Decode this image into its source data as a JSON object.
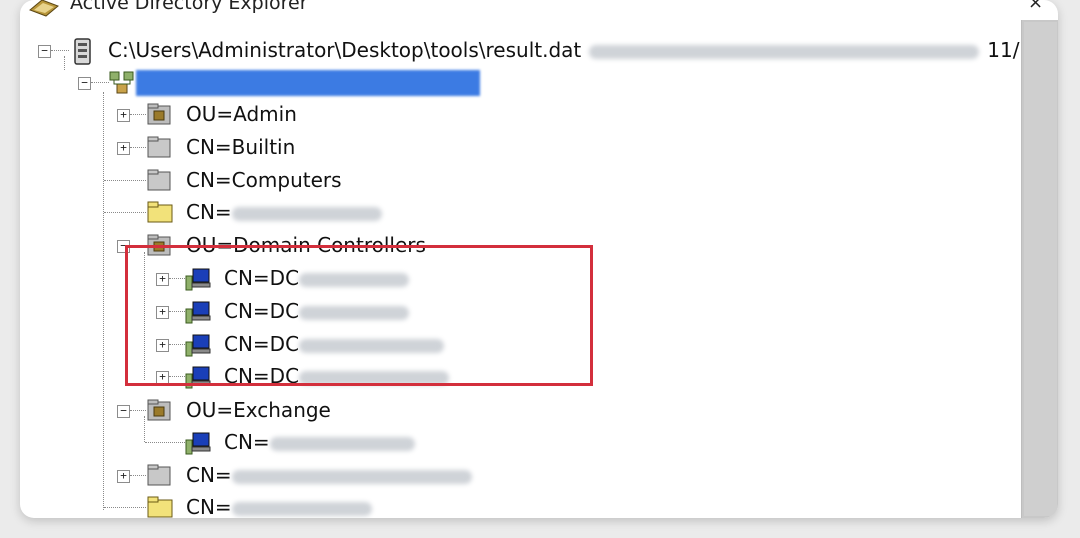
{
  "window": {
    "title": "Active Directory Explorer",
    "close_glyph": "×",
    "app_icon": "ad-explorer-icon"
  },
  "tree": {
    "root": {
      "path": "C:\\Users\\Administrator\\Desktop\\tools\\result.dat",
      "suffix": "11/",
      "icon": "database-icon",
      "expander": "−"
    },
    "domain": {
      "icon": "domain-icon",
      "expander": "−"
    },
    "items": [
      {
        "label": "OU=Admin",
        "icon": "ou-folder-icon",
        "expander": "+"
      },
      {
        "label": "CN=Builtin",
        "icon": "container-folder-icon",
        "expander": "+"
      },
      {
        "label": "CN=Computers",
        "icon": "container-folder-icon",
        "expander": ""
      },
      {
        "label": "CN=",
        "icon": "yellow-folder-icon",
        "expander": ""
      },
      {
        "label": "OU=Domain Controllers",
        "icon": "ou-folder-icon",
        "expander": "−"
      },
      {
        "label": "CN=DC",
        "icon": "computer-icon",
        "expander": "+"
      },
      {
        "label": "CN=DC",
        "icon": "computer-icon",
        "expander": "+"
      },
      {
        "label": "CN=DC",
        "icon": "computer-icon",
        "expander": "+"
      },
      {
        "label": "CN=DC",
        "icon": "computer-icon",
        "expander": "+"
      },
      {
        "label": "OU=Exchange",
        "icon": "ou-folder-icon",
        "expander": "−"
      },
      {
        "label": "CN=",
        "icon": "computer-icon",
        "expander": ""
      },
      {
        "label": "CN=",
        "icon": "container-folder-icon",
        "expander": "+"
      },
      {
        "label": "CN=",
        "icon": "yellow-folder-icon",
        "expander": ""
      }
    ]
  },
  "colors": {
    "highlight_border": "#d32f3c",
    "selection": "#3c7be3"
  }
}
